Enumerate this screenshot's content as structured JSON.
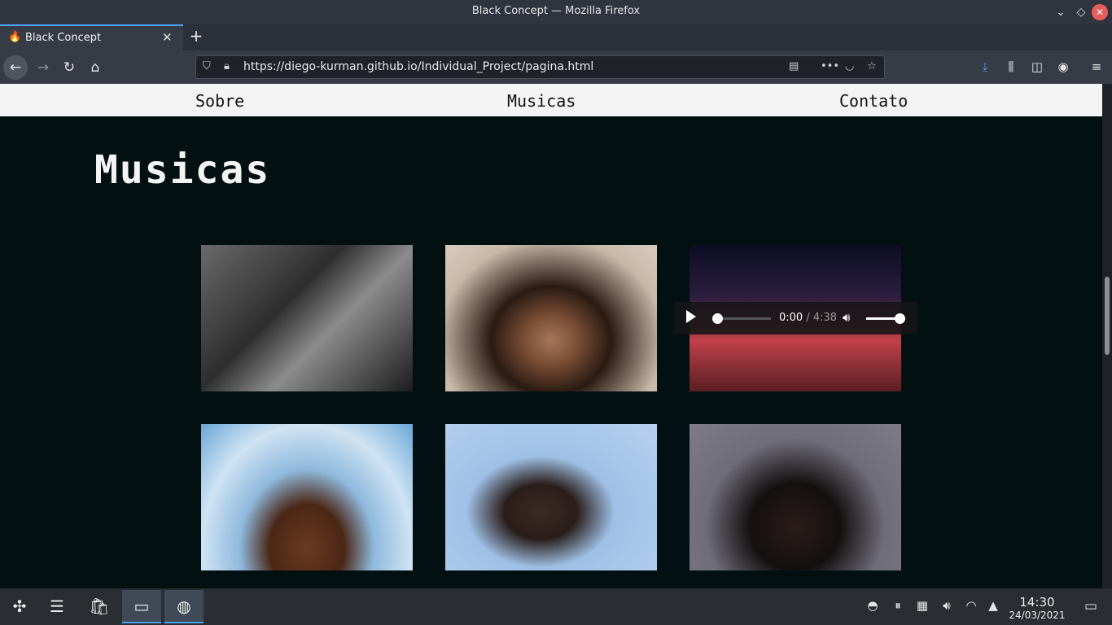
{
  "window": {
    "title": "Black Concept — Mozilla Firefox"
  },
  "tab": {
    "label": "Black Concept"
  },
  "urlbar": {
    "url": "https://diego-kurman.github.io/Individual_Project/pagina.html"
  },
  "site": {
    "nav": [
      "Sobre",
      "Musicas",
      "Contato"
    ],
    "heading": "Musicas"
  },
  "player": {
    "current": "0:00",
    "separator": " / ",
    "duration": "4:38",
    "progress": 0.0,
    "volume": 1.0
  },
  "taskbar": {
    "time": "14:30",
    "date": "24/03/2021"
  },
  "icons": {
    "firefox_tab": "flame-icon",
    "back": "arrow-left-icon",
    "forward": "arrow-right-icon",
    "reload": "reload-icon",
    "home": "home-icon",
    "shield": "shield-icon",
    "lock": "lock-icon",
    "reader": "reader-view-icon",
    "more": "ellipsis-icon",
    "pocket": "pocket-icon",
    "star": "star-icon",
    "download": "download-icon",
    "library": "library-icon",
    "sidebar": "sidebar-icon",
    "account": "account-icon",
    "menu": "hamburger-icon"
  }
}
